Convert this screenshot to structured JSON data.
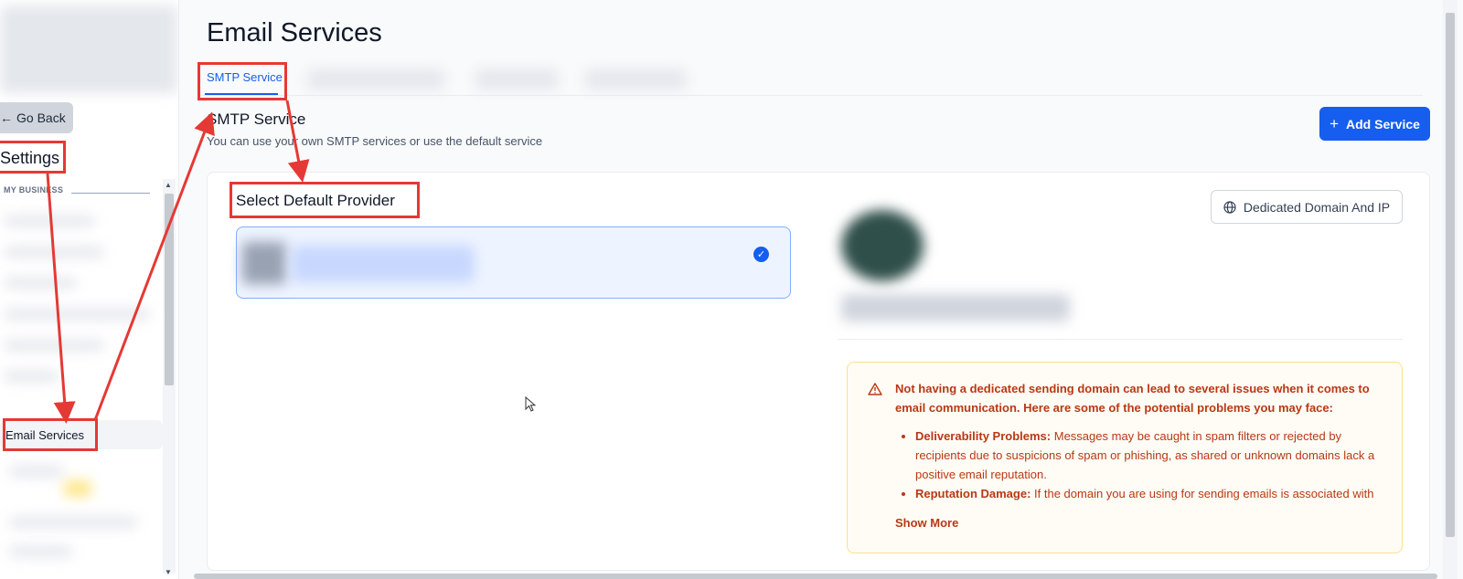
{
  "sidebar": {
    "go_back_label": "Go Back",
    "settings_title": "Settings",
    "section_label": "MY BUSINESS",
    "active_item_label": "Email Services"
  },
  "main": {
    "page_title": "Email Services",
    "active_tab_label": "SMTP Service",
    "section_title": "SMTP Service",
    "section_subtitle": "You can use your own SMTP services or use the default service",
    "add_service_label": "Add Service",
    "select_provider_label": "Select Default Provider",
    "dedicated_button_label": "Dedicated Domain And IP"
  },
  "warning": {
    "heading": "Not having a dedicated sending domain can lead to several issues when it comes to email communication. Here are some of the potential problems you may face:",
    "items": [
      {
        "title": "Deliverability Problems:",
        "text": "Messages may be caught in spam filters or rejected by recipients due to suspicions of spam or phishing, as shared or unknown domains lack a positive email reputation."
      },
      {
        "title": "Reputation Damage:",
        "text": "If the domain you are using for sending emails is associated with"
      }
    ],
    "show_more_label": "Show More"
  },
  "icons": {
    "back": "arrow-left-icon",
    "plus": "plus-icon",
    "globe": "globe-icon",
    "check": "check-circle-icon",
    "warning": "warning-triangle-icon"
  },
  "colors": {
    "primary": "#155eef",
    "annotation": "#e53935",
    "warning_text": "#b93815",
    "warning_bg": "#fffcf5"
  }
}
